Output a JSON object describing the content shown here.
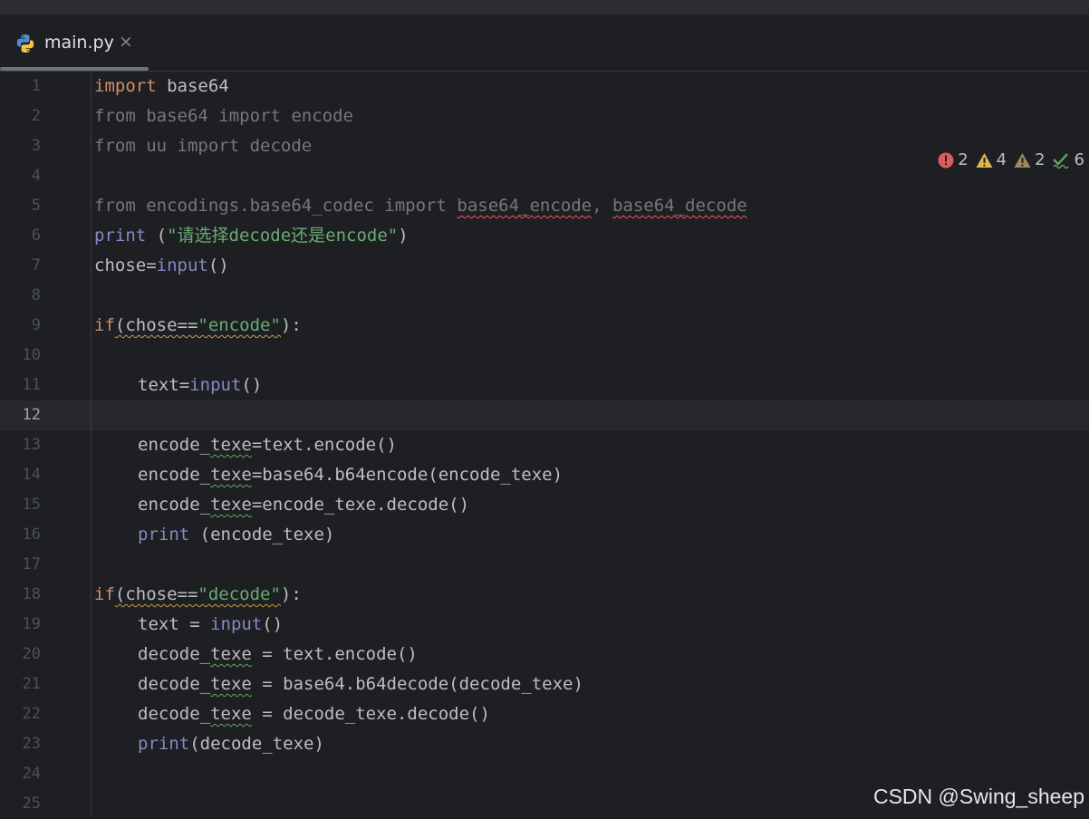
{
  "tab": {
    "filename": "main.py",
    "close_glyph": "×",
    "icon": "python-icon"
  },
  "inspections": {
    "errors": "2",
    "warnings": "4",
    "weak_warnings": "2",
    "typos": "6"
  },
  "current_line": "12",
  "lines": [
    "1",
    "2",
    "3",
    "4",
    "5",
    "6",
    "7",
    "8",
    "9",
    "10",
    "11",
    "12",
    "13",
    "14",
    "15",
    "16",
    "17",
    "18",
    "19",
    "20",
    "21",
    "22",
    "23",
    "24",
    "25"
  ],
  "code": {
    "l1": {
      "kw": "import",
      "rest": " base64"
    },
    "l2": {
      "text": "from base64 import encode"
    },
    "l3": {
      "text": "from uu import decode"
    },
    "l5": {
      "pre": "from encodings.base64_codec import ",
      "a": "base64_encode",
      "sep": ", ",
      "b": "base64_decode"
    },
    "l6": {
      "fn": "print",
      "open": " (",
      "str": "\"请选择decode还是encode\"",
      "close": ")"
    },
    "l7": {
      "pre": "chose=",
      "fn": "input",
      "post": "()"
    },
    "l9": {
      "kw": "if",
      "p1": "(chose==",
      "str": "\"encode\"",
      "p2": "):"
    },
    "l11": {
      "pre": "text=",
      "fn": "input",
      "post": "()"
    },
    "l13": {
      "a": "encode_",
      "b": "texe",
      "c": "=text.encode()"
    },
    "l14": {
      "a": "encode_",
      "b": "texe",
      "c": "=base64.b64encode(encode_texe)"
    },
    "l15": {
      "a": "encode_",
      "b": "texe",
      "c": "=encode_texe.decode()"
    },
    "l16": {
      "fn": "print",
      "post": " (encode_texe)"
    },
    "l18": {
      "kw": "if",
      "p1": "(chose==",
      "str": "\"decode\"",
      "p2": "):"
    },
    "l19": {
      "pre": "text = ",
      "fn": "input",
      "post": "()"
    },
    "l20": {
      "a": "decode_",
      "b": "texe",
      "c": " = text.encode()"
    },
    "l21": {
      "a": "decode_",
      "b": "texe",
      "c": " = base64.b64decode(decode_texe)"
    },
    "l22": {
      "a": "decode_",
      "b": "texe",
      "c": " = decode_texe.decode()"
    },
    "l23": {
      "fn": "print",
      "post": "(decode_texe)"
    }
  },
  "watermark": "CSDN @Swing_sheep",
  "colors": {
    "background": "#1e1f22",
    "keyword": "#cf8e6d",
    "builtin": "#8888c6",
    "string": "#6aab73",
    "error": "#f75464",
    "warning": "#e0b84a",
    "ok": "#5fa865"
  }
}
